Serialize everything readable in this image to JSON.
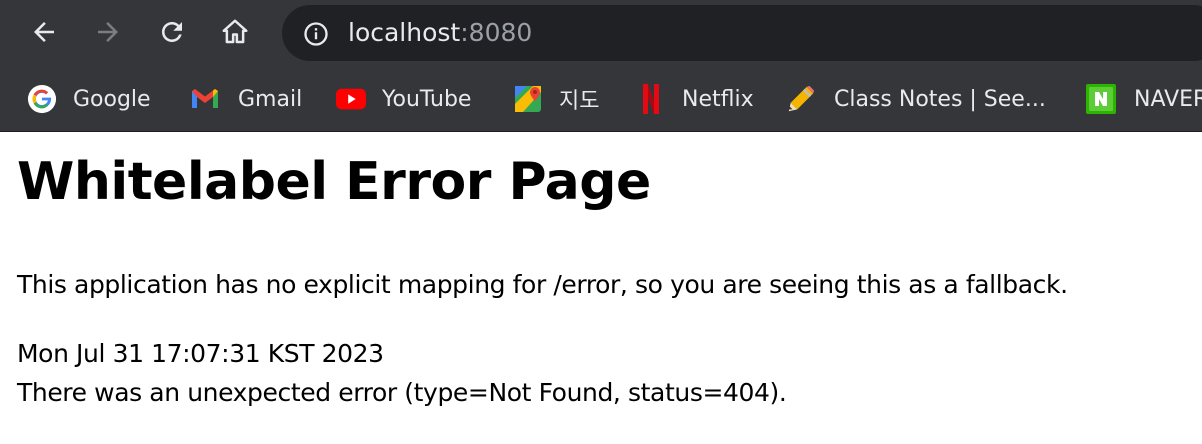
{
  "browser": {
    "url_host": "localhost",
    "url_port": ":8080",
    "nav": {
      "back_icon": "arrow-left-icon",
      "forward_icon": "arrow-right-icon",
      "reload_icon": "reload-icon",
      "home_icon": "home-icon",
      "info_icon": "info-icon"
    },
    "colors": {
      "toolbar_bg": "#35363a",
      "omnibox_bg": "#202124",
      "text": "#e8eaed",
      "muted": "#9aa0a6"
    }
  },
  "bookmarks": [
    {
      "label": "Google",
      "icon": "google-icon"
    },
    {
      "label": "Gmail",
      "icon": "gmail-icon"
    },
    {
      "label": "YouTube",
      "icon": "youtube-icon"
    },
    {
      "label": "지도",
      "icon": "maps-icon"
    },
    {
      "label": "Netflix",
      "icon": "netflix-icon"
    },
    {
      "label": "Class Notes | See...",
      "icon": "pencil-icon"
    },
    {
      "label": "NAVER",
      "icon": "naver-icon"
    }
  ],
  "page": {
    "title": "Whitelabel Error Page",
    "message": "This application has no explicit mapping for /error, so you are seeing this as a fallback.",
    "timestamp": "Mon Jul 31 17:07:31 KST 2023",
    "error_detail": "There was an unexpected error (type=Not Found, status=404)."
  }
}
